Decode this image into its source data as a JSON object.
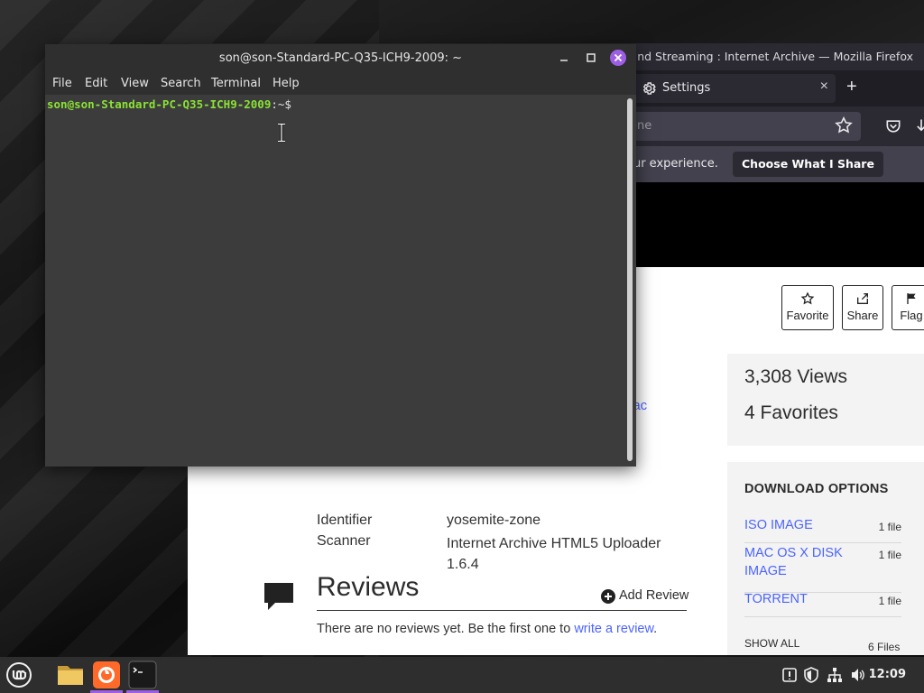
{
  "firefox": {
    "window_title": "nd Streaming : Internet Archive — Mozilla Firefox",
    "tab_label": "Settings",
    "tab_close": "×",
    "new_tab": "+",
    "url_fragment": "one",
    "notice_text": "our experience.",
    "notice_button": "Choose What I Share"
  },
  "archive_page": {
    "actions": {
      "favorite": "Favorite",
      "share": "Share",
      "flag": "Flag"
    },
    "link_fragment": "lac",
    "stats": {
      "views": "3,308 Views",
      "favorites": "4 Favorites"
    },
    "metadata": [
      {
        "key": "Identifier",
        "value": "yosemite-zone"
      },
      {
        "key": "Scanner",
        "value": "Internet Archive HTML5 Uploader 1.6.4"
      }
    ],
    "download_options": {
      "title": "DOWNLOAD OPTIONS",
      "items": [
        {
          "name": "ISO IMAGE",
          "count": "1 file"
        },
        {
          "name": "MAC OS X DISK IMAGE",
          "count": "1 file"
        },
        {
          "name": "TORRENT",
          "count": "1 file"
        }
      ],
      "show_all": "SHOW ALL",
      "show_all_count": "6 Files"
    },
    "reviews": {
      "title": "Reviews",
      "add_review": "Add Review",
      "empty_text": "There are no reviews yet. Be the first one to ",
      "empty_link": "write a review",
      "empty_end": "."
    }
  },
  "terminal": {
    "title": "son@son-Standard-PC-Q35-ICH9-2009: ~",
    "menu": [
      "File",
      "Edit",
      "View",
      "Search",
      "Terminal",
      "Help"
    ],
    "prompt_user": "son@son-Standard-PC-Q35-ICH9-2009",
    "prompt_path": ":~$"
  },
  "taskbar": {
    "apps": [
      "files-icon",
      "firefox-icon",
      "terminal-icon"
    ],
    "clock": "12:09"
  },
  "colors": {
    "accent": "#9c5fe3",
    "prompt_green": "#8ae234",
    "link_blue": "#4b64ff"
  }
}
